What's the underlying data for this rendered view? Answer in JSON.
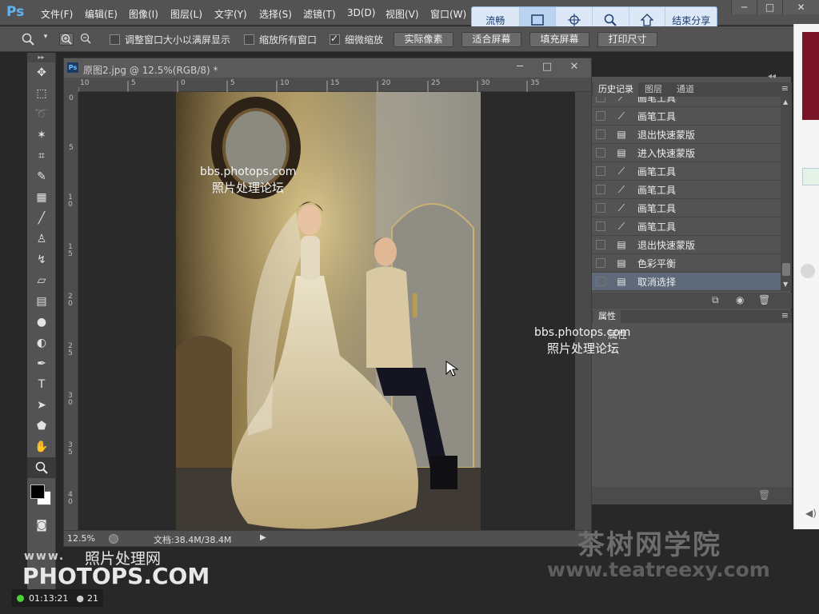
{
  "app": {
    "logo": "Ps",
    "title": ""
  },
  "menu": [
    {
      "label": "文件(F)"
    },
    {
      "label": "编辑(E)"
    },
    {
      "label": "图像(I)"
    },
    {
      "label": "图层(L)"
    },
    {
      "label": "文字(Y)"
    },
    {
      "label": "选择(S)"
    },
    {
      "label": "滤镜(T)"
    },
    {
      "label": "3D(D)"
    },
    {
      "label": "视图(V)"
    },
    {
      "label": "窗口(W)"
    }
  ],
  "share_bar": {
    "items": [
      "流畅",
      "结束分享"
    ]
  },
  "options": {
    "resize_windows_label": "调整窗口大小以满屏显示",
    "zoom_all_label": "缩放所有窗口",
    "scrubby_label": "细微缩放",
    "scrubby_checked": true,
    "btn_actual": "实际像素",
    "btn_fit": "适合屏幕",
    "btn_fill": "填充屏幕",
    "btn_print": "打印尺寸"
  },
  "document": {
    "title": "原图2.jpg @ 12.5%(RGB/8) *",
    "zoom": "12.5%",
    "doc_size": "文档:38.4M/38.4M",
    "hruler_labels": [
      "10",
      "5",
      "0",
      "5",
      "10",
      "15",
      "20",
      "25",
      "30",
      "35"
    ],
    "vruler_labels": [
      "0",
      "5",
      "10",
      "15",
      "20",
      "25",
      "30",
      "35",
      "40"
    ]
  },
  "history": {
    "tabs": [
      "历史记录",
      "图层",
      "通道"
    ],
    "items": [
      {
        "label": "画笔工具",
        "icon": "brush-icon"
      },
      {
        "label": "画笔工具",
        "icon": "brush-icon"
      },
      {
        "label": "退出快速蒙版",
        "icon": "document-icon"
      },
      {
        "label": "进入快速蒙版",
        "icon": "document-icon"
      },
      {
        "label": "画笔工具",
        "icon": "brush-icon"
      },
      {
        "label": "画笔工具",
        "icon": "brush-icon"
      },
      {
        "label": "画笔工具",
        "icon": "brush-icon"
      },
      {
        "label": "画笔工具",
        "icon": "brush-icon"
      },
      {
        "label": "退出快速蒙版",
        "icon": "document-icon"
      },
      {
        "label": "色彩平衡",
        "icon": "document-icon"
      },
      {
        "label": "取消选择",
        "icon": "document-icon",
        "selected": true
      }
    ]
  },
  "properties": {
    "tab": "属性",
    "body_label": "属性"
  },
  "watermarks": {
    "forum_url": "bbs.photops.com",
    "forum_name": "照片处理论坛",
    "photops_www": "www.",
    "photops_cn": "照片处理网",
    "photops_com": "PHOTOPS.COM",
    "tea_cn": "茶树网学院",
    "tea_url": "www.teatreexy.com"
  },
  "status_overlay": {
    "time": "01:13:21",
    "count": "21"
  },
  "colors": {
    "accent": "#5fb4f2",
    "panel": "#535353",
    "selection": "#5e6a7a"
  }
}
